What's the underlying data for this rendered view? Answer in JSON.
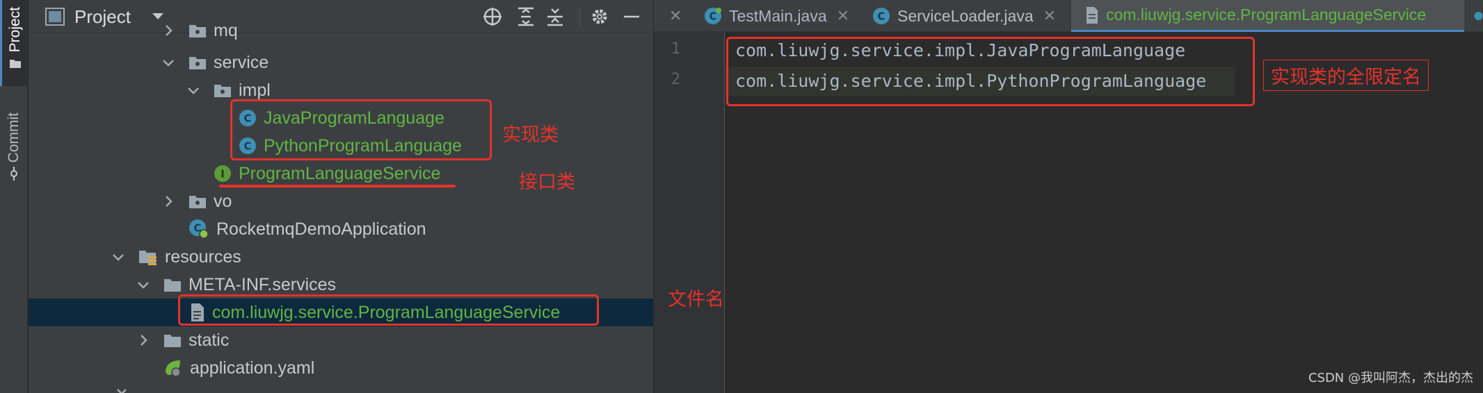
{
  "tool_strip": {
    "project_label": "Project",
    "commit_label": "Commit"
  },
  "project_panel": {
    "title": "Project",
    "header_icons": [
      "crosshair-icon",
      "expand-all-icon",
      "collapse-all-icon",
      "gear-icon",
      "minimize-icon"
    ],
    "tree": [
      {
        "label": "mq",
        "kind": "package",
        "expanded": false
      },
      {
        "label": "service",
        "kind": "package",
        "expanded": true
      },
      {
        "label": "impl",
        "kind": "package",
        "expanded": true
      },
      {
        "label": "JavaProgramLanguage",
        "kind": "class"
      },
      {
        "label": "PythonProgramLanguage",
        "kind": "class"
      },
      {
        "label": "ProgramLanguageService",
        "kind": "interface"
      },
      {
        "label": "vo",
        "kind": "package",
        "expanded": false
      },
      {
        "label": "RocketmqDemoApplication",
        "kind": "spring-boot-class"
      },
      {
        "label": "resources",
        "kind": "resources-folder",
        "expanded": true
      },
      {
        "label": "META-INF.services",
        "kind": "folder",
        "expanded": true
      },
      {
        "label": "com.liuwjg.service.ProgramLanguageService",
        "kind": "file",
        "selected": true
      },
      {
        "label": "static",
        "kind": "folder",
        "expanded": false
      },
      {
        "label": "application.yaml",
        "kind": "yaml"
      }
    ]
  },
  "editor": {
    "tabs": [
      {
        "label": "TestMain.java",
        "active": false
      },
      {
        "label": "ServiceLoader.java",
        "active": false
      },
      {
        "label": "com.liuwjg.service.ProgramLanguageService",
        "active": true
      }
    ],
    "lines": [
      {
        "number": "1",
        "text": "com.liuwjg.service.impl.JavaProgramLanguage"
      },
      {
        "number": "2",
        "text": "com.liuwjg.service.impl.PythonProgramLanguage"
      }
    ]
  },
  "annotations": {
    "impl_classes": "实现类",
    "interface_class": "接口类",
    "file_name": "文件名",
    "fully_qualified_name": "实现类的全限定名"
  },
  "watermark": "CSDN @我叫阿杰，杰出的杰",
  "colors": {
    "accent": "#4a88c7",
    "green_text": "#62b543",
    "annotation_red": "#e5322b",
    "selection": "#0d293e"
  }
}
